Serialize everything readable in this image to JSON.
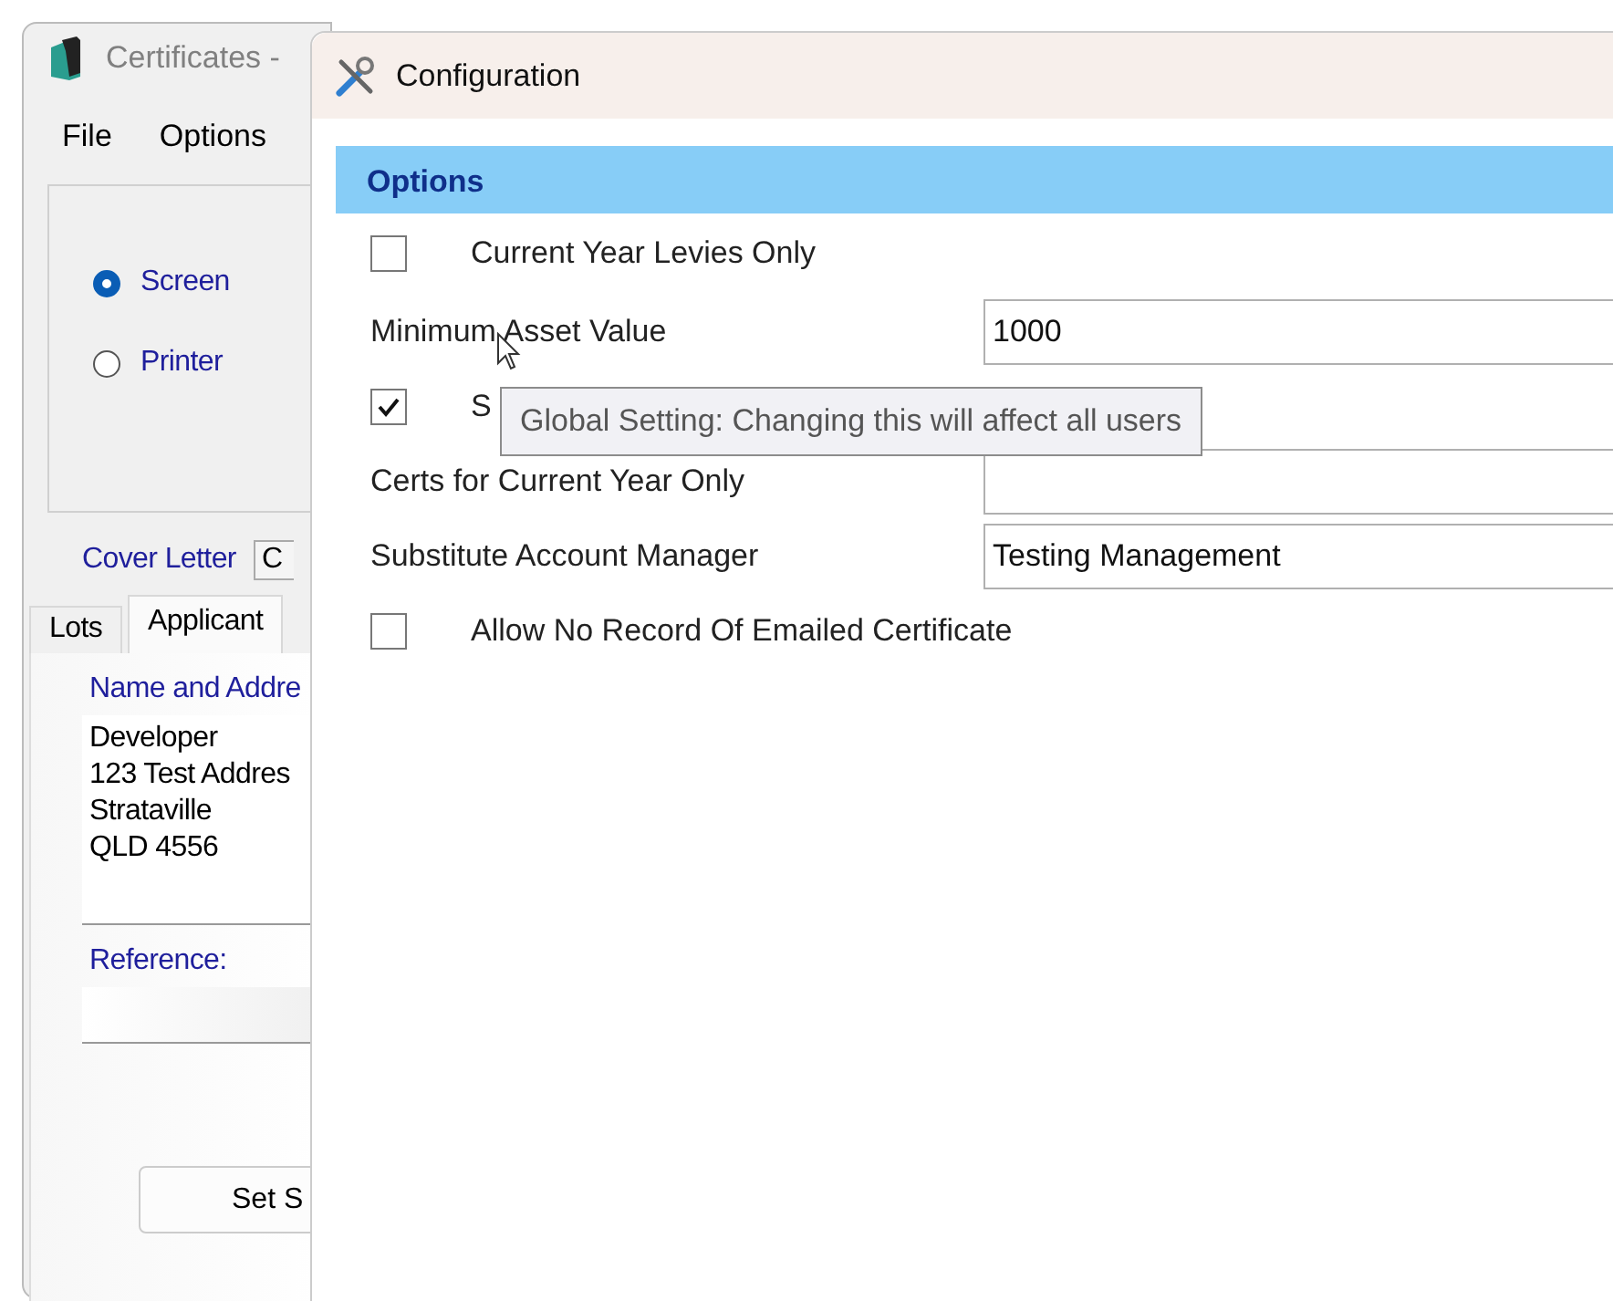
{
  "background_window": {
    "title": "Certificates -",
    "menu": [
      "File",
      "Options"
    ],
    "output_options": [
      {
        "label": "Screen",
        "selected": true
      },
      {
        "label": "Printer",
        "selected": false
      }
    ],
    "cover_letter": {
      "label": "Cover Letter",
      "value": "C"
    },
    "tabs": [
      {
        "label": "Lots",
        "selected": false
      },
      {
        "label": "Applicant",
        "selected": true
      }
    ],
    "name_address": {
      "label": "Name and Addre",
      "lines": [
        "Developer",
        "123 Test Addres",
        "Strataville",
        "QLD 4556"
      ]
    },
    "reference": {
      "label": "Reference:"
    },
    "button": "Set S"
  },
  "dialog": {
    "title": "Configuration",
    "section": "Options",
    "rows": [
      {
        "kind": "checkbox",
        "label": "Current Year Levies Only",
        "checked": false
      },
      {
        "kind": "field",
        "label": "Minimum Asset Value",
        "value": "1000"
      },
      {
        "kind": "checkbox",
        "label": "S",
        "checked": true
      },
      {
        "kind": "field",
        "label": "Certs for Current Year Only"
      },
      {
        "kind": "field",
        "label": "Substitute Account Manager",
        "value": "Testing Management"
      },
      {
        "kind": "checkbox",
        "label": "Allow No Record Of Emailed Certificate",
        "checked": false
      }
    ],
    "tooltip": "Global Setting: Changing this will affect all users"
  }
}
